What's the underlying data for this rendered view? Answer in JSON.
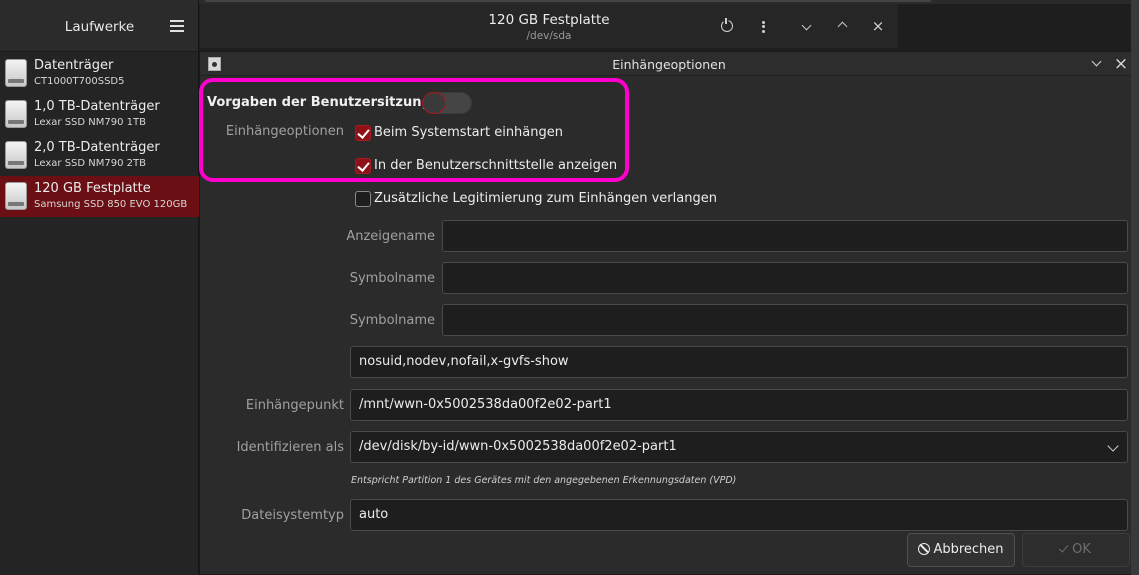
{
  "sidebar": {
    "title": "Laufwerke",
    "drives": [
      {
        "name": "Datenträger",
        "model": "CT1000T700SSD5",
        "selected": false
      },
      {
        "name": "1,0 TB-Datenträger",
        "model": "Lexar SSD NM790 1TB",
        "selected": false
      },
      {
        "name": "2,0 TB-Datenträger",
        "model": "Lexar SSD NM790 2TB",
        "selected": false
      },
      {
        "name": "120 GB Festplatte",
        "model": "Samsung SSD 850 EVO 120GB",
        "selected": true
      }
    ]
  },
  "header": {
    "title": "120 GB Festplatte",
    "subtitle": "/dev/sda"
  },
  "dialog": {
    "title": "Einhängeoptionen",
    "session_defaults_label": "Vorgaben der Benutzersitzung",
    "session_defaults_enabled": false,
    "mount_options_label": "Einhängeoptionen",
    "checkboxes": [
      {
        "label": "Beim Systemstart einhängen",
        "checked": true
      },
      {
        "label": "In der Benutzerschnittstelle anzeigen",
        "checked": true
      },
      {
        "label": "Zusätzliche Legitimierung zum Einhängen verlangen",
        "checked": false
      }
    ],
    "display_name_label": "Anzeigename",
    "display_name_value": "",
    "icon_name_label": "Symbolname",
    "icon_name_value": "",
    "symbolic_icon_label": "Symbolname",
    "symbolic_icon_value": "",
    "options_value": "nosuid,nodev,nofail,x-gvfs-show",
    "mount_point_label": "Einhängepunkt",
    "mount_point_value": "/mnt/wwn-0x5002538da00f2e02-part1",
    "identify_as_label": "Identifizieren als",
    "identify_as_value": "/dev/disk/by-id/wwn-0x5002538da00f2e02-part1",
    "identify_note": "Entspricht Partition 1 des Gerätes mit den angegebenen Erkennungsdaten (VPD)",
    "fs_type_label": "Dateisystemtyp",
    "fs_type_value": "auto",
    "cancel_label": "Abbrechen",
    "ok_label": "OK",
    "ok_enabled": false
  },
  "colors": {
    "accent": "#8e1118",
    "selection": "#6b0f14",
    "highlight_annotation": "#ff00cc"
  }
}
